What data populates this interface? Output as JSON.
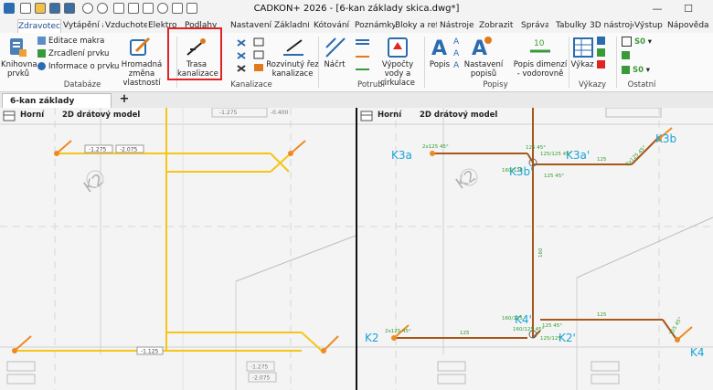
{
  "app": {
    "title": "CADKON+ 2026 - [6-kan základy skica.dwg*]",
    "minimize": "—",
    "maximize": "☐"
  },
  "tabs": [
    "Zdravotech",
    "Vytápění a",
    "Vzduchotec",
    "Elektro",
    "Podlahy",
    "Nastavení a",
    "Základní",
    "Kótování",
    "Poznámky",
    "Bloky a refe",
    "Nástroje",
    "Zobrazit",
    "Správa",
    "Tabulky",
    "3D nástroje",
    "Výstup",
    "Nápověda"
  ],
  "ribbon": {
    "databaze": {
      "label": "Databáze",
      "knihovna": "Knihovna prvků",
      "editace": "Editace makra",
      "zrcadleni": "Zrcadlení prvku",
      "informace": "Informace o prvku",
      "hromadna": "Hromadná změna vlastností"
    },
    "kanalizace": {
      "label": "Kanalizace",
      "trasa": "Trasa kanalizace",
      "rozvinuty": "Rozvinutý řez kanalizace"
    },
    "potrubi": {
      "label": "Potrubí",
      "nacrt": "Náčrt",
      "vypocty": "Výpočty vody a cirkulace"
    },
    "popisy": {
      "label": "Popisy",
      "popis": "Popis",
      "nastaveni": "Nastavení popisů",
      "dimenze": "Popis dimenzí - vodorovně"
    },
    "vykazy": {
      "label": "Výkazy",
      "vykaz": "Výkaz"
    },
    "ostatni": {
      "label": "Ostatní",
      "val1": "S0",
      "val2": "S0"
    }
  },
  "document": {
    "tab": "6-kan základy skica.dwg*",
    "add": "+"
  },
  "views": {
    "left": {
      "view": "Horní",
      "style": "2D drátový model"
    },
    "right": {
      "view": "Horní",
      "style": "2D drátový model"
    }
  },
  "drawing": {
    "left_labels": [
      "K2",
      "-1.275",
      "-2.075",
      "-1.275",
      "-0.400",
      "-1.125",
      "-1.275",
      "-2.075"
    ],
    "right_labels": {
      "k3a": "K3a",
      "k3b": "K3b",
      "k3a_prime": "K3a'",
      "k3b_prime": "K3b'",
      "k2": "K2",
      "k2_prime": "K2'",
      "k4": "K4",
      "k4_prime": "K4'",
      "k2_big": "K2"
    },
    "pipe_labels": [
      "2x125 45°",
      "125 45°",
      "125/125 45°",
      "160/125",
      "125 45°",
      "160",
      "160/125",
      "125 45°",
      "125",
      "125",
      "2x125 45°",
      "125/125",
      "125 45°",
      "2x125 45°",
      "125",
      "160/125 45°"
    ],
    "colors": {
      "pipe_yellow": "#f5c518",
      "pipe_orange": "#ee8a22",
      "pipe_brown": "#a8571a",
      "label_cyan": "#1aa3d9",
      "dim_green": "#2f9d2f",
      "highlight_red": "#e02424"
    }
  }
}
